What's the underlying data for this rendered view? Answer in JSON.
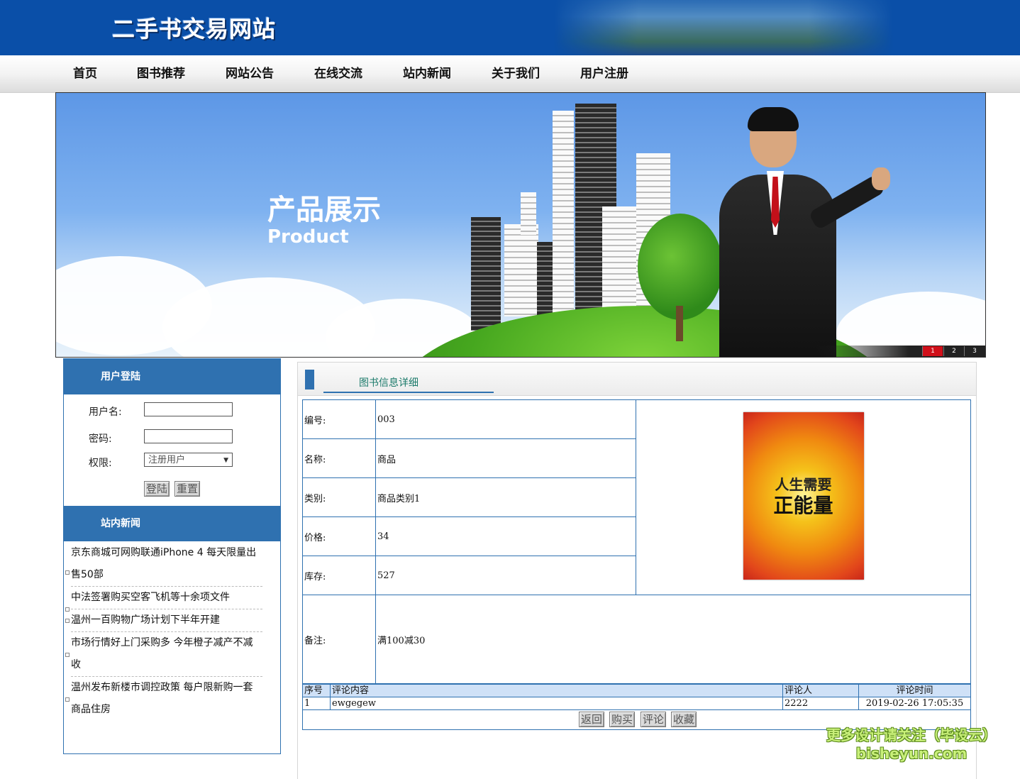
{
  "header": {
    "site_title": "二手书交易网站"
  },
  "nav": {
    "items": [
      "首页",
      "图书推荐",
      "网站公告",
      "在线交流",
      "站内新闻",
      "关于我们",
      "用户注册"
    ]
  },
  "banner": {
    "title": "产品展示",
    "subtitle": "Product",
    "slides": [
      "1",
      "2",
      "3"
    ],
    "active_slide": 1
  },
  "login": {
    "heading": "用户登陆",
    "username_label": "用户名:",
    "password_label": "密码:",
    "role_label": "权限:",
    "role_selected": "注册用户",
    "login_button": "登陆",
    "reset_button": "重置"
  },
  "news": {
    "heading": "站内新闻",
    "items": [
      "京东商城可网购联通iPhone 4 每天限量出售50部",
      "中法签署购买空客飞机等十余项文件",
      "温州一百购物广场计划下半年开建",
      "市场行情好上门采购多 今年橙子减产不减收",
      "温州发布新楼市调控政策 每户限新购一套商品住房"
    ]
  },
  "detail": {
    "heading": "图书信息详细",
    "fields": {
      "id_label": "编号:",
      "id_value": "003",
      "name_label": "名称:",
      "name_value": "商品",
      "category_label": "类别:",
      "category_value": "商品类别1",
      "price_label": "价格:",
      "price_value": "34",
      "stock_label": "库存:",
      "stock_value": "527",
      "remark_label": "备注:",
      "remark_value": "满100减30"
    },
    "cover": {
      "line1": "人生需要",
      "line2": "正能量"
    }
  },
  "comments": {
    "headers": [
      "序号",
      "评论内容",
      "评论人",
      "评论时间"
    ],
    "rows": [
      [
        "1",
        "ewgegew",
        "2222",
        "2019-02-26 17:05:35"
      ]
    ]
  },
  "actions": {
    "back": "返回",
    "buy": "购买",
    "comment": "评论",
    "favorite": "收藏"
  },
  "watermark": {
    "line1": "更多设计请关注（毕设云）",
    "line2": "bisheyun.com"
  }
}
